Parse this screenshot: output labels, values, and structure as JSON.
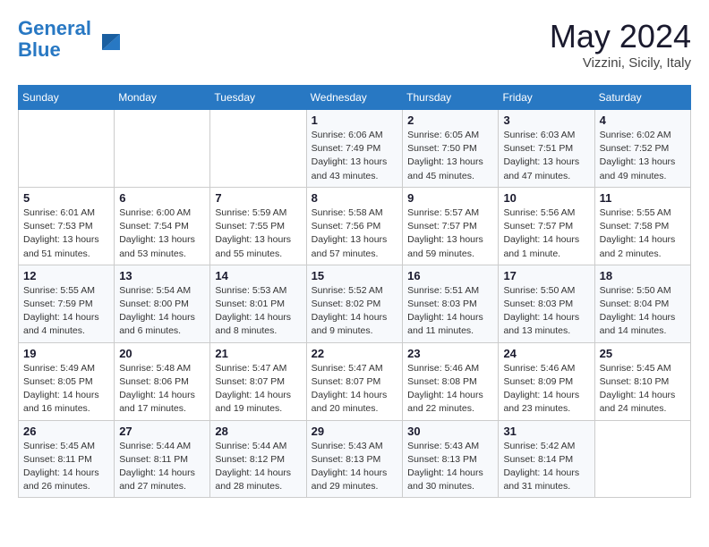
{
  "header": {
    "logo_line1": "General",
    "logo_line2": "Blue",
    "month": "May 2024",
    "location": "Vizzini, Sicily, Italy"
  },
  "weekdays": [
    "Sunday",
    "Monday",
    "Tuesday",
    "Wednesday",
    "Thursday",
    "Friday",
    "Saturday"
  ],
  "weeks": [
    [
      {
        "day": "",
        "info": ""
      },
      {
        "day": "",
        "info": ""
      },
      {
        "day": "",
        "info": ""
      },
      {
        "day": "1",
        "info": "Sunrise: 6:06 AM\nSunset: 7:49 PM\nDaylight: 13 hours\nand 43 minutes."
      },
      {
        "day": "2",
        "info": "Sunrise: 6:05 AM\nSunset: 7:50 PM\nDaylight: 13 hours\nand 45 minutes."
      },
      {
        "day": "3",
        "info": "Sunrise: 6:03 AM\nSunset: 7:51 PM\nDaylight: 13 hours\nand 47 minutes."
      },
      {
        "day": "4",
        "info": "Sunrise: 6:02 AM\nSunset: 7:52 PM\nDaylight: 13 hours\nand 49 minutes."
      }
    ],
    [
      {
        "day": "5",
        "info": "Sunrise: 6:01 AM\nSunset: 7:53 PM\nDaylight: 13 hours\nand 51 minutes."
      },
      {
        "day": "6",
        "info": "Sunrise: 6:00 AM\nSunset: 7:54 PM\nDaylight: 13 hours\nand 53 minutes."
      },
      {
        "day": "7",
        "info": "Sunrise: 5:59 AM\nSunset: 7:55 PM\nDaylight: 13 hours\nand 55 minutes."
      },
      {
        "day": "8",
        "info": "Sunrise: 5:58 AM\nSunset: 7:56 PM\nDaylight: 13 hours\nand 57 minutes."
      },
      {
        "day": "9",
        "info": "Sunrise: 5:57 AM\nSunset: 7:57 PM\nDaylight: 13 hours\nand 59 minutes."
      },
      {
        "day": "10",
        "info": "Sunrise: 5:56 AM\nSunset: 7:57 PM\nDaylight: 14 hours\nand 1 minute."
      },
      {
        "day": "11",
        "info": "Sunrise: 5:55 AM\nSunset: 7:58 PM\nDaylight: 14 hours\nand 2 minutes."
      }
    ],
    [
      {
        "day": "12",
        "info": "Sunrise: 5:55 AM\nSunset: 7:59 PM\nDaylight: 14 hours\nand 4 minutes."
      },
      {
        "day": "13",
        "info": "Sunrise: 5:54 AM\nSunset: 8:00 PM\nDaylight: 14 hours\nand 6 minutes."
      },
      {
        "day": "14",
        "info": "Sunrise: 5:53 AM\nSunset: 8:01 PM\nDaylight: 14 hours\nand 8 minutes."
      },
      {
        "day": "15",
        "info": "Sunrise: 5:52 AM\nSunset: 8:02 PM\nDaylight: 14 hours\nand 9 minutes."
      },
      {
        "day": "16",
        "info": "Sunrise: 5:51 AM\nSunset: 8:03 PM\nDaylight: 14 hours\nand 11 minutes."
      },
      {
        "day": "17",
        "info": "Sunrise: 5:50 AM\nSunset: 8:03 PM\nDaylight: 14 hours\nand 13 minutes."
      },
      {
        "day": "18",
        "info": "Sunrise: 5:50 AM\nSunset: 8:04 PM\nDaylight: 14 hours\nand 14 minutes."
      }
    ],
    [
      {
        "day": "19",
        "info": "Sunrise: 5:49 AM\nSunset: 8:05 PM\nDaylight: 14 hours\nand 16 minutes."
      },
      {
        "day": "20",
        "info": "Sunrise: 5:48 AM\nSunset: 8:06 PM\nDaylight: 14 hours\nand 17 minutes."
      },
      {
        "day": "21",
        "info": "Sunrise: 5:47 AM\nSunset: 8:07 PM\nDaylight: 14 hours\nand 19 minutes."
      },
      {
        "day": "22",
        "info": "Sunrise: 5:47 AM\nSunset: 8:07 PM\nDaylight: 14 hours\nand 20 minutes."
      },
      {
        "day": "23",
        "info": "Sunrise: 5:46 AM\nSunset: 8:08 PM\nDaylight: 14 hours\nand 22 minutes."
      },
      {
        "day": "24",
        "info": "Sunrise: 5:46 AM\nSunset: 8:09 PM\nDaylight: 14 hours\nand 23 minutes."
      },
      {
        "day": "25",
        "info": "Sunrise: 5:45 AM\nSunset: 8:10 PM\nDaylight: 14 hours\nand 24 minutes."
      }
    ],
    [
      {
        "day": "26",
        "info": "Sunrise: 5:45 AM\nSunset: 8:11 PM\nDaylight: 14 hours\nand 26 minutes."
      },
      {
        "day": "27",
        "info": "Sunrise: 5:44 AM\nSunset: 8:11 PM\nDaylight: 14 hours\nand 27 minutes."
      },
      {
        "day": "28",
        "info": "Sunrise: 5:44 AM\nSunset: 8:12 PM\nDaylight: 14 hours\nand 28 minutes."
      },
      {
        "day": "29",
        "info": "Sunrise: 5:43 AM\nSunset: 8:13 PM\nDaylight: 14 hours\nand 29 minutes."
      },
      {
        "day": "30",
        "info": "Sunrise: 5:43 AM\nSunset: 8:13 PM\nDaylight: 14 hours\nand 30 minutes."
      },
      {
        "day": "31",
        "info": "Sunrise: 5:42 AM\nSunset: 8:14 PM\nDaylight: 14 hours\nand 31 minutes."
      },
      {
        "day": "",
        "info": ""
      }
    ]
  ]
}
